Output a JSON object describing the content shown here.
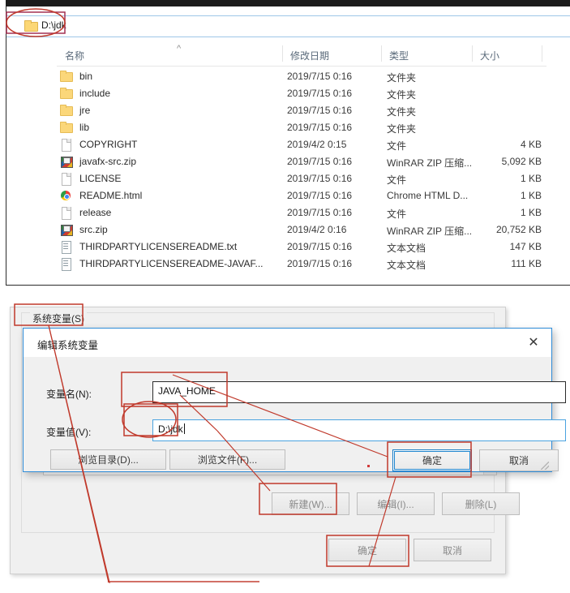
{
  "explorer": {
    "address": {
      "path": "D:\\jdk",
      "icon": "folder-icon"
    },
    "columns": [
      {
        "key": "name",
        "label": "名称"
      },
      {
        "key": "date",
        "label": "修改日期"
      },
      {
        "key": "type",
        "label": "类型"
      },
      {
        "key": "size",
        "label": "大小"
      }
    ],
    "sort_indicator": "^",
    "files": [
      {
        "name": "bin",
        "icon": "folder-icon",
        "date": "2019/7/15 0:16",
        "type": "文件夹",
        "size": ""
      },
      {
        "name": "include",
        "icon": "folder-icon",
        "date": "2019/7/15 0:16",
        "type": "文件夹",
        "size": ""
      },
      {
        "name": "jre",
        "icon": "folder-icon",
        "date": "2019/7/15 0:16",
        "type": "文件夹",
        "size": ""
      },
      {
        "name": "lib",
        "icon": "folder-icon",
        "date": "2019/7/15 0:16",
        "type": "文件夹",
        "size": ""
      },
      {
        "name": "COPYRIGHT",
        "icon": "file-icon",
        "date": "2019/4/2 0:15",
        "type": "文件",
        "size": "4 KB"
      },
      {
        "name": "javafx-src.zip",
        "icon": "zip-icon",
        "date": "2019/7/15 0:16",
        "type": "WinRAR ZIP 压缩...",
        "size": "5,092 KB"
      },
      {
        "name": "LICENSE",
        "icon": "file-icon",
        "date": "2019/7/15 0:16",
        "type": "文件",
        "size": "1 KB"
      },
      {
        "name": "README.html",
        "icon": "chrome-icon",
        "date": "2019/7/15 0:16",
        "type": "Chrome HTML D...",
        "size": "1 KB"
      },
      {
        "name": "release",
        "icon": "file-icon",
        "date": "2019/7/15 0:16",
        "type": "文件",
        "size": "1 KB"
      },
      {
        "name": "src.zip",
        "icon": "zip-icon",
        "date": "2019/4/2 0:16",
        "type": "WinRAR ZIP 压缩...",
        "size": "20,752 KB"
      },
      {
        "name": "THIRDPARTYLICENSEREADME.txt",
        "icon": "text-icon",
        "date": "2019/7/15 0:16",
        "type": "文本文档",
        "size": "147 KB"
      },
      {
        "name": "THIRDPARTYLICENSEREADME-JAVAF...",
        "icon": "text-icon",
        "date": "2019/7/15 0:16",
        "type": "文本文档",
        "size": "111 KB"
      }
    ]
  },
  "env_window": {
    "system_variables_label": "系统变量(S)",
    "buttons": {
      "new": "新建(W)...",
      "edit": "编辑(I)...",
      "delete": "删除(L)",
      "ok": "确定",
      "cancel": "取消"
    }
  },
  "edit_dialog": {
    "title": "编辑系统变量",
    "close_icon": "close-icon",
    "fields": [
      {
        "label": "变量名(N):",
        "value": "JAVA_HOME"
      },
      {
        "label": "变量值(V):",
        "value": "D:\\jdk"
      }
    ],
    "buttons": {
      "browse_dir": "浏览目录(D)...",
      "browse_file": "浏览文件(F)...",
      "ok": "确定",
      "cancel": "取消"
    }
  },
  "annotations": {
    "color": "#c0392b",
    "highlight_boxes": [
      "address-path",
      "system-variables-label",
      "variable-name-input",
      "variable-value-input",
      "dialog-ok-button",
      "new-button",
      "env-ok-button"
    ],
    "ellipses": [
      "address-path",
      "variable-value-input"
    ]
  }
}
